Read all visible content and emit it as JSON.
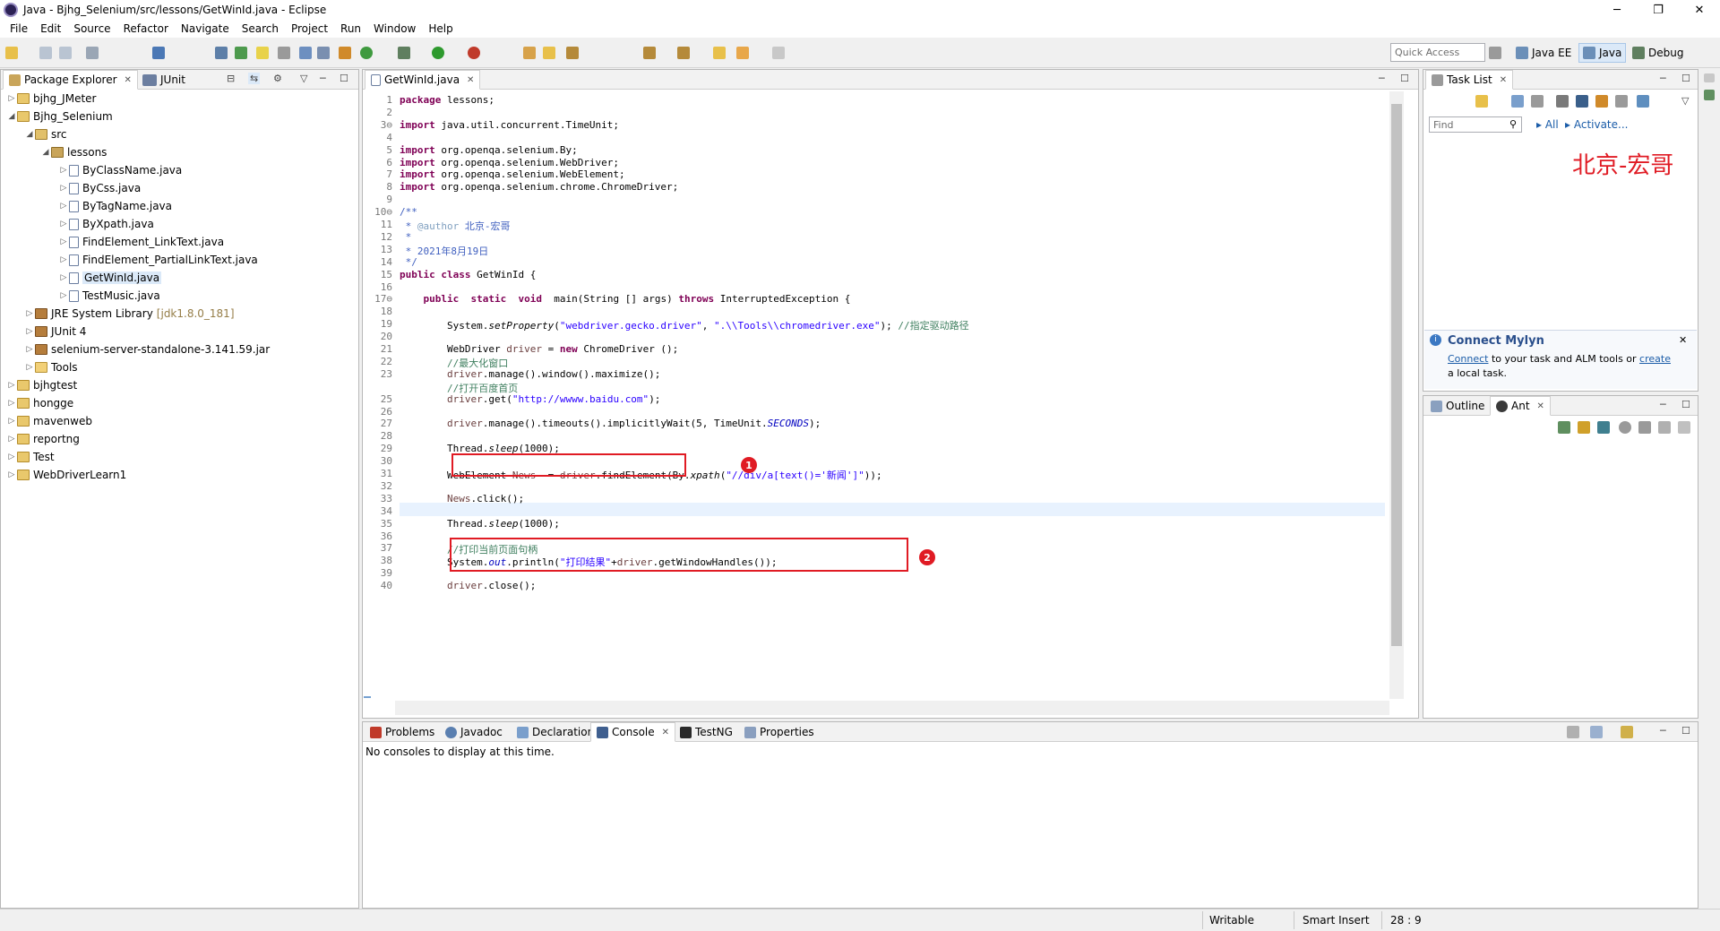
{
  "window": {
    "title": "Java - Bjhg_Selenium/src/lessons/GetWinId.java - Eclipse",
    "controls": [
      "─",
      "❐",
      "✕"
    ]
  },
  "menu": [
    "File",
    "Edit",
    "Source",
    "Refactor",
    "Navigate",
    "Search",
    "Project",
    "Run",
    "Window",
    "Help"
  ],
  "toolbar": {
    "quick_access_placeholder": "Quick Access",
    "perspectives": [
      "Java EE",
      "Java",
      "Debug"
    ],
    "active_perspective": "Java"
  },
  "left_panel": {
    "tabs": [
      "Package Explorer",
      "JUnit"
    ],
    "tree": [
      {
        "label": "bjhg_JMeter",
        "icon": "project-icon",
        "expanded": false
      },
      {
        "label": "Bjhg_Selenium",
        "icon": "project-icon",
        "expanded": true
      },
      {
        "label": "src",
        "icon": "source-folder-icon",
        "expanded": true
      },
      {
        "label": "lessons",
        "icon": "package-icon",
        "expanded": true
      },
      {
        "label": "ByClassName.java",
        "icon": "java-file-icon"
      },
      {
        "label": "ByCss.java",
        "icon": "java-file-icon"
      },
      {
        "label": "ByTagName.java",
        "icon": "java-file-icon"
      },
      {
        "label": "ByXpath.java",
        "icon": "java-file-icon"
      },
      {
        "label": "FindElement_LinkText.java",
        "icon": "java-file-icon"
      },
      {
        "label": "FindElement_PartialLinkText.java",
        "icon": "java-file-icon"
      },
      {
        "label": "GetWinId.java",
        "icon": "java-file-icon",
        "selected": true
      },
      {
        "label": "TestMusic.java",
        "icon": "java-file-icon"
      },
      {
        "label": "JRE System Library",
        "icon": "library-icon",
        "suffix": "[jdk1.8.0_181]"
      },
      {
        "label": "JUnit 4",
        "icon": "library-icon"
      },
      {
        "label": "selenium-server-standalone-3.141.59.jar",
        "icon": "jar-icon"
      },
      {
        "label": "Tools",
        "icon": "folder-icon"
      },
      {
        "label": "bjhgtest",
        "icon": "project-icon"
      },
      {
        "label": "hongge",
        "icon": "project-icon"
      },
      {
        "label": "mavenweb",
        "icon": "project-icon"
      },
      {
        "label": "reportng",
        "icon": "project-icon"
      },
      {
        "label": "Test",
        "icon": "project-icon"
      },
      {
        "label": "WebDriverLearn1",
        "icon": "project-icon"
      }
    ]
  },
  "editor": {
    "tab": "GetWinId.java",
    "lines": [
      {
        "n": "1",
        "html": "<span class='kw'>package</span> lessons;"
      },
      {
        "n": "2",
        "html": ""
      },
      {
        "n": "3⊖",
        "html": "<span class='kw'>import</span> java.util.concurrent.TimeUnit;"
      },
      {
        "n": "4",
        "html": ""
      },
      {
        "n": "5",
        "html": "<span class='kw'>import</span> org.openqa.selenium.By;"
      },
      {
        "n": "6",
        "html": "<span class='kw'>import</span> org.openqa.selenium.WebDriver;"
      },
      {
        "n": "7",
        "html": "<span class='kw'>import</span> org.openqa.selenium.WebElement;"
      },
      {
        "n": "8",
        "html": "<span class='kw'>import</span> org.openqa.selenium.chrome.ChromeDriver;"
      },
      {
        "n": "9",
        "html": ""
      },
      {
        "n": "10⊖",
        "html": "<span class='jd'>/**</span>"
      },
      {
        "n": "11",
        "html": "<span class='jd'> * </span><span class='ann'>@author</span><span class='jd'> 北京-宏哥</span>"
      },
      {
        "n": "12",
        "html": "<span class='jd'> *</span>"
      },
      {
        "n": "13",
        "html": "<span class='jd'> * 2021年8月19日</span>"
      },
      {
        "n": "14",
        "html": "<span class='jd'> */</span>"
      },
      {
        "n": "15",
        "html": "<span class='kw'>public</span> <span class='kw'>class</span> GetWinId {"
      },
      {
        "n": "16",
        "html": ""
      },
      {
        "n": "17⊖",
        "html": "    <span class='kw'>public</span>  <span class='kw'>static</span>  <span class='kw'>void</span>  main(String [] args) <span class='kw'>throws</span> InterruptedException {"
      },
      {
        "n": "18",
        "html": ""
      },
      {
        "n": "19",
        "html": "        System.<span class='it'>setProperty</span>(<span class='str'>\"webdriver.gecko.driver\"</span>, <span class='str'>\".\\\\Tools\\\\chromedriver.exe\"</span>); <span class='cmt'>//指定驱动路径</span>"
      },
      {
        "n": "20",
        "html": ""
      },
      {
        "n": "21",
        "html": "        WebDriver <span class='var'>driver</span> = <span class='kw'>new</span> ChromeDriver ();"
      },
      {
        "n": "22",
        "html": "        <span class='cmt'>//最大化窗口</span>"
      },
      {
        "n": "23",
        "html": "        <span class='var'>driver</span>.manage().window().maximize();"
      },
      {
        "n": "",
        "html": "        <span class='cmt'>//打开百度首页</span>"
      },
      {
        "n": "25",
        "html": "        <span class='var'>driver</span>.get(<span class='str'>\"http://wwww.baidu.com\"</span>);"
      },
      {
        "n": "26",
        "html": ""
      },
      {
        "n": "27",
        "html": "        <span class='var'>driver</span>.manage().timeouts().implicitlyWait(5, TimeUnit.<span class='fld it'>SECONDS</span>);"
      },
      {
        "n": "28",
        "html": ""
      },
      {
        "n": "29",
        "html": "        Thread.<span class='it'>sleep</span>(1000);"
      },
      {
        "n": "30",
        "html": ""
      },
      {
        "n": "31",
        "html": "        WebElement <span class='var'>News</span>  = <span class='var'>driver</span>.findElement(By.<span class='it'>xpath</span>(<span class='str'>\"//div/a[text()='新闻']\"</span>));"
      },
      {
        "n": "32",
        "html": ""
      },
      {
        "n": "33",
        "html": "        <span class='var'>News</span>.click();"
      },
      {
        "n": "34",
        "html": ""
      },
      {
        "n": "35",
        "html": "        Thread.<span class='it'>sleep</span>(1000);"
      },
      {
        "n": "36",
        "html": ""
      },
      {
        "n": "37",
        "html": "        <span class='cmt'>//打印当前页面句柄</span>"
      },
      {
        "n": "38",
        "html": "        System.<span class='fld it'>out</span>.println(<span class='str'>\"打印结果\"</span>+<span class='var'>driver</span>.getWindowHandles());"
      },
      {
        "n": "39",
        "html": ""
      },
      {
        "n": "40",
        "html": "        <span class='var'>driver</span>.close();"
      }
    ],
    "badges": [
      "1",
      "2"
    ]
  },
  "right_panel": {
    "task_list_tab": "Task List",
    "find_placeholder": "Find",
    "filter_all": "All",
    "filter_activate": "Activate...",
    "watermark": "北京-宏哥",
    "mylyn_title": "Connect Mylyn",
    "mylyn_link_connect": "Connect",
    "mylyn_text1": " to your task and ALM tools or ",
    "mylyn_link_create": "create",
    "mylyn_text2": "a local task.",
    "outline_tabs": [
      "Outline",
      "Ant"
    ]
  },
  "bottom_panel": {
    "tabs": [
      "Problems",
      "Javadoc",
      "Declaration",
      "Console",
      "TestNG",
      "Properties"
    ],
    "active_tab": "Console",
    "console_message": "No consoles to display at this time."
  },
  "status": {
    "writable": "Writable",
    "insert_mode": "Smart Insert",
    "position": "28 : 9"
  }
}
